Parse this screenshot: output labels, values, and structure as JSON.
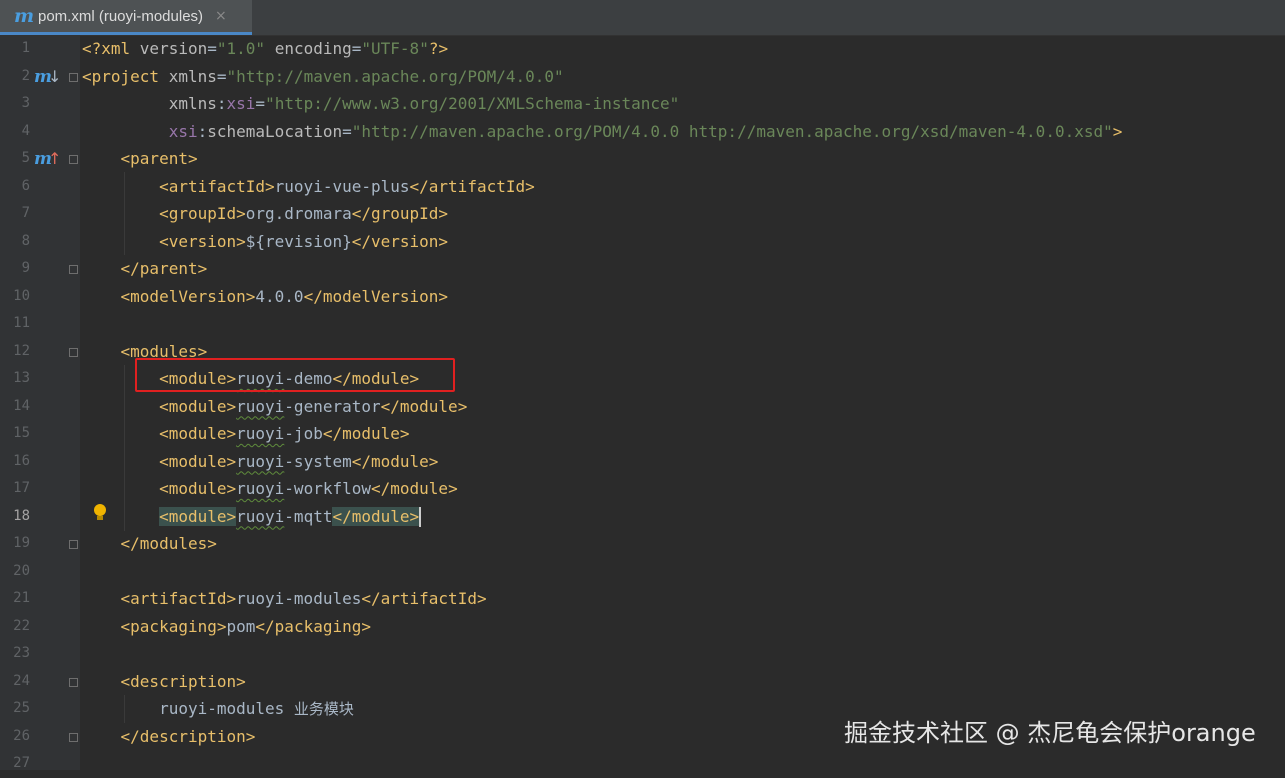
{
  "tab": {
    "file_icon": "m",
    "title": "pom.xml (ruoyi-modules)",
    "close": "×"
  },
  "gutter_icons": {
    "maven_letter": "m",
    "line2_arrow": "↓",
    "line5_arrow": "↑",
    "line2_arrow_color": "#a9b7c6",
    "line5_arrow_color": "#e06c5c"
  },
  "editor": {
    "current_line": 18,
    "lines": [
      [
        [
          "tag",
          "<?xml "
        ],
        [
          "an",
          "version"
        ],
        [
          "pl",
          "="
        ],
        [
          "av",
          "\"1.0\""
        ],
        [
          "pl",
          " "
        ],
        [
          "an",
          "encoding"
        ],
        [
          "pl",
          "="
        ],
        [
          "av",
          "\"UTF-8\""
        ],
        [
          "tag",
          "?>"
        ]
      ],
      [
        [
          "tag",
          "<project "
        ],
        [
          "an",
          "xmlns"
        ],
        [
          "pl",
          "="
        ],
        [
          "av",
          "\"http://maven.apache.org/POM/4.0.0\""
        ]
      ],
      [
        [
          "pl",
          "         "
        ],
        [
          "an",
          "xmlns"
        ],
        [
          "pl",
          ":"
        ],
        [
          "ns",
          "xsi"
        ],
        [
          "pl",
          "="
        ],
        [
          "av",
          "\"http://www.w3.org/2001/XMLSchema-instance\""
        ]
      ],
      [
        [
          "pl",
          "         "
        ],
        [
          "ns",
          "xsi"
        ],
        [
          "pl",
          ":"
        ],
        [
          "an",
          "schemaLocation"
        ],
        [
          "pl",
          "="
        ],
        [
          "av",
          "\"http://maven.apache.org/POM/4.0.0 http://maven.apache.org/xsd/maven-4.0.0.xsd\""
        ],
        [
          "tag",
          ">"
        ]
      ],
      [
        [
          "pl",
          "    "
        ],
        [
          "tag",
          "<parent>"
        ]
      ],
      [
        [
          "pl",
          "        "
        ],
        [
          "tag",
          "<artifactId>"
        ],
        [
          "pl",
          "ruoyi-vue-plus"
        ],
        [
          "tag",
          "</artifactId>"
        ]
      ],
      [
        [
          "pl",
          "        "
        ],
        [
          "tag",
          "<groupId>"
        ],
        [
          "pl",
          "org.dromara"
        ],
        [
          "tag",
          "</groupId>"
        ]
      ],
      [
        [
          "pl",
          "        "
        ],
        [
          "tag",
          "<version>"
        ],
        [
          "pl",
          "${revision}"
        ],
        [
          "tag",
          "</version>"
        ]
      ],
      [
        [
          "pl",
          "    "
        ],
        [
          "tag",
          "</parent>"
        ]
      ],
      [
        [
          "pl",
          "    "
        ],
        [
          "tag",
          "<modelVersion>"
        ],
        [
          "pl",
          "4.0.0"
        ],
        [
          "tag",
          "</modelVersion>"
        ]
      ],
      [],
      [
        [
          "pl",
          "    "
        ],
        [
          "tag",
          "<modules>"
        ]
      ],
      [
        [
          "pl",
          "        "
        ],
        [
          "tag",
          "<module>"
        ],
        [
          "wavy",
          "ruoyi"
        ],
        [
          "pl",
          "-demo"
        ],
        [
          "tag",
          "</module>"
        ]
      ],
      [
        [
          "pl",
          "        "
        ],
        [
          "tag",
          "<module>"
        ],
        [
          "wavy",
          "ruoyi"
        ],
        [
          "pl",
          "-generator"
        ],
        [
          "tag",
          "</module>"
        ]
      ],
      [
        [
          "pl",
          "        "
        ],
        [
          "tag",
          "<module>"
        ],
        [
          "wavy",
          "ruoyi"
        ],
        [
          "pl",
          "-job"
        ],
        [
          "tag",
          "</module>"
        ]
      ],
      [
        [
          "pl",
          "        "
        ],
        [
          "tag",
          "<module>"
        ],
        [
          "wavy",
          "ruoyi"
        ],
        [
          "pl",
          "-system"
        ],
        [
          "tag",
          "</module>"
        ]
      ],
      [
        [
          "pl",
          "        "
        ],
        [
          "tag",
          "<module>"
        ],
        [
          "wavy",
          "ruoyi"
        ],
        [
          "pl",
          "-workflow"
        ],
        [
          "tag",
          "</module>"
        ]
      ],
      [
        [
          "pl",
          "        "
        ],
        [
          "taghl",
          "<module>"
        ],
        [
          "wavy",
          "ruoyi"
        ],
        [
          "pl",
          "-mqtt"
        ],
        [
          "taghl",
          "</module>"
        ],
        [
          "cursor",
          ""
        ]
      ],
      [
        [
          "pl",
          "    "
        ],
        [
          "tag",
          "</modules>"
        ]
      ],
      [],
      [
        [
          "pl",
          "    "
        ],
        [
          "tag",
          "<artifactId>"
        ],
        [
          "pl",
          "ruoyi-modules"
        ],
        [
          "tag",
          "</artifactId>"
        ]
      ],
      [
        [
          "pl",
          "    "
        ],
        [
          "tag",
          "<packaging>"
        ],
        [
          "pl",
          "pom"
        ],
        [
          "tag",
          "</packaging>"
        ]
      ],
      [],
      [
        [
          "pl",
          "    "
        ],
        [
          "tag",
          "<description>"
        ]
      ],
      [
        [
          "pl",
          "        "
        ],
        [
          "pl",
          "ruoyi-modules "
        ],
        [
          "cjk",
          "业务模块"
        ]
      ],
      [
        [
          "pl",
          "    "
        ],
        [
          "tag",
          "</description>"
        ]
      ],
      []
    ]
  },
  "watermark": "掘金技术社区 @ 杰尼龟会保护orange",
  "colors": {
    "background": "#2b2b2b",
    "tag": "#e8bf6a",
    "attr_value": "#6a8759",
    "namespace": "#9876aa",
    "plain": "#a9b7c6",
    "highlight_box": "#e02020"
  }
}
